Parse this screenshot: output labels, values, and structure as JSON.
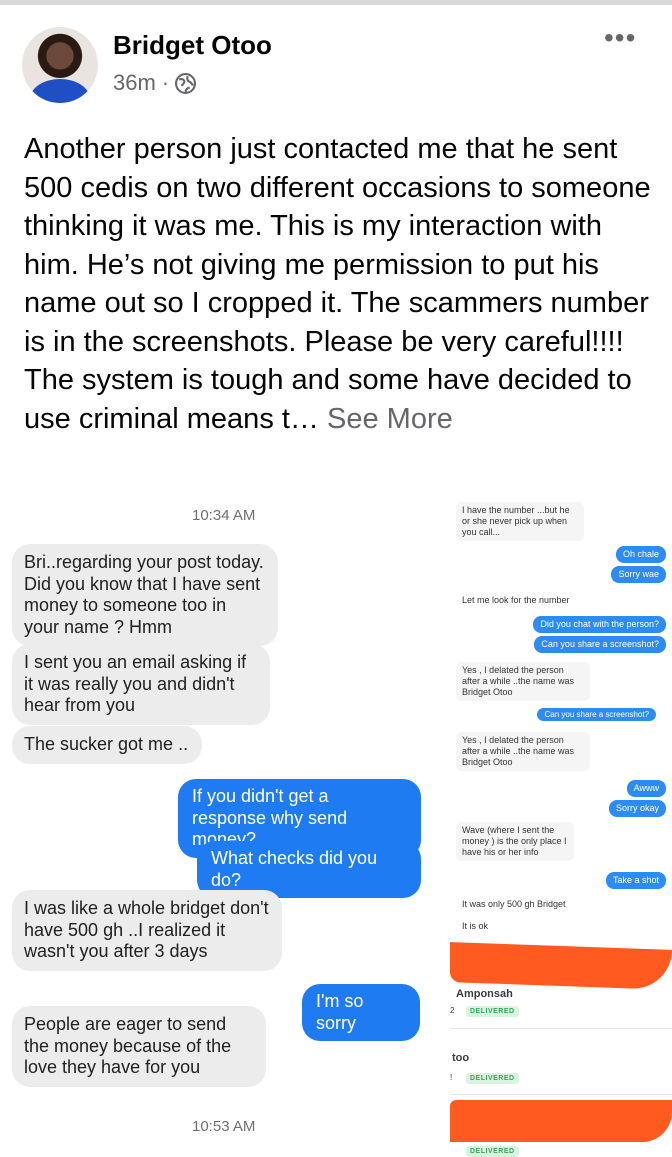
{
  "post": {
    "author": "Bridget Otoo",
    "time": "36m",
    "separator": "·",
    "more_label": "•••",
    "text": "Another person just contacted me that he sent 500 cedis on two different occasions to someone thinking it was me. This is my interaction with him. He’s not giving me permission to put his name out so I cropped it. The scammers number is in the screenshots. Please be very careful!!!! The system is tough and some have decided to use criminal means t…",
    "see_more": "See More"
  },
  "left_chat": {
    "time_top": "10:34 AM",
    "time_bottom": "10:53 AM",
    "messages": [
      {
        "dir": "in",
        "text": "Bri..regarding your post today. Did you know that I have sent money to someone too in your name ? Hmm"
      },
      {
        "dir": "in",
        "text": "I sent you an email asking if it was really you and didn't hear from you"
      },
      {
        "dir": "in",
        "text": "The sucker got me .."
      },
      {
        "dir": "out",
        "text": "If you didn't get a response why send money?"
      },
      {
        "dir": "out",
        "text": "What checks did you do?"
      },
      {
        "dir": "in",
        "text": "I was like a whole bridget don't have 500 gh ..I realized it wasn't you after 3 days"
      },
      {
        "dir": "out",
        "text": "I'm so sorry"
      },
      {
        "dir": "in",
        "text": "People are eager to send the money because of the love they have for you"
      }
    ]
  },
  "right_chat": {
    "messages": [
      {
        "dir": "in",
        "text": "I have the number ...but he or she never pick up when you call..."
      },
      {
        "dir": "out",
        "text": "Oh chale"
      },
      {
        "dir": "out",
        "text": "Sorry wae"
      },
      {
        "dir": "in",
        "text": "Let me look for the number"
      },
      {
        "dir": "out",
        "text": "Did you chat with the person?"
      },
      {
        "dir": "out",
        "text": "Can you share a screenshot?"
      },
      {
        "dir": "in",
        "text": "Yes , I delated the person after a while ..the name was Bridget Otoo"
      },
      {
        "dir": "out",
        "text": "Can you share a screenshot?"
      },
      {
        "dir": "in",
        "text": "Yes , I delated the person after a while ..the name was Bridget Otoo"
      },
      {
        "dir": "out",
        "text": "Awww"
      },
      {
        "dir": "out",
        "text": "Sorry okay"
      },
      {
        "dir": "in",
        "text": "Wave (where I sent the money ) is the only place I have his or her info"
      },
      {
        "dir": "out",
        "text": "Take a shot"
      },
      {
        "dir": "in",
        "text": "It was only 500 gh Bridget"
      },
      {
        "dir": "in",
        "text": "It is ok"
      }
    ],
    "contacts": [
      {
        "name": "Amponsah",
        "status": "DELIVERED",
        "prefix": "2"
      },
      {
        "name": "too",
        "status": "DELIVERED",
        "prefix": "!"
      },
      {
        "name": "",
        "status": "DELIVERED",
        "prefix": ""
      }
    ]
  },
  "colors": {
    "accent_blue": "#1f7bf2",
    "bubble_grey": "#ececec",
    "redaction_orange": "#ff5a1f",
    "meta_grey": "#65676b"
  }
}
